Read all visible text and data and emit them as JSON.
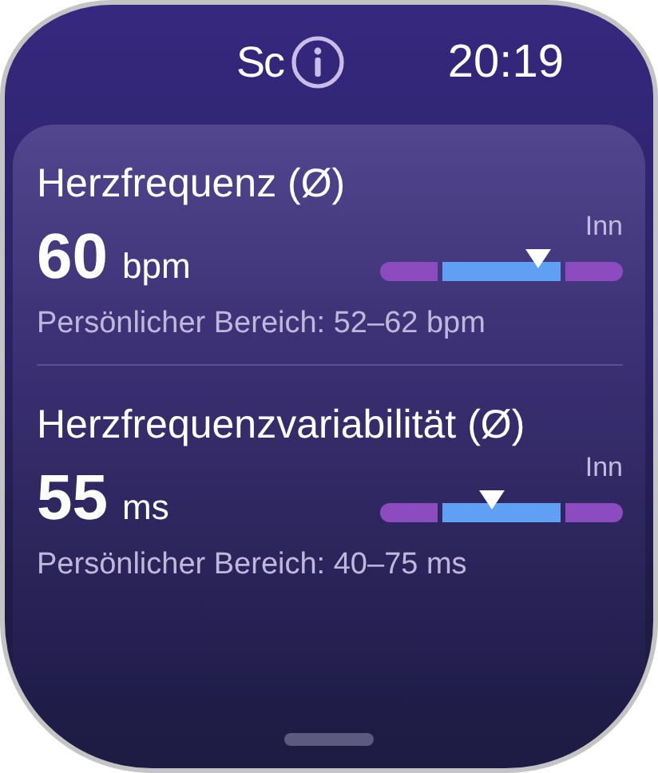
{
  "status_bar": {
    "app_label": "Sc",
    "time": "20:19"
  },
  "metrics": [
    {
      "title": "Herzfrequenz (Ø)",
      "value": "60",
      "unit": "bpm",
      "range_label": "Inn",
      "level": 0.65,
      "range_text": "Persönlicher Bereich: 52–62 bpm"
    },
    {
      "title": "Herzfrequenzvariabilität (Ø)",
      "value": "55",
      "unit": "ms",
      "range_label": "Inn",
      "level": 0.46,
      "range_text": "Persönlicher Bereich: 40–75 ms"
    }
  ]
}
